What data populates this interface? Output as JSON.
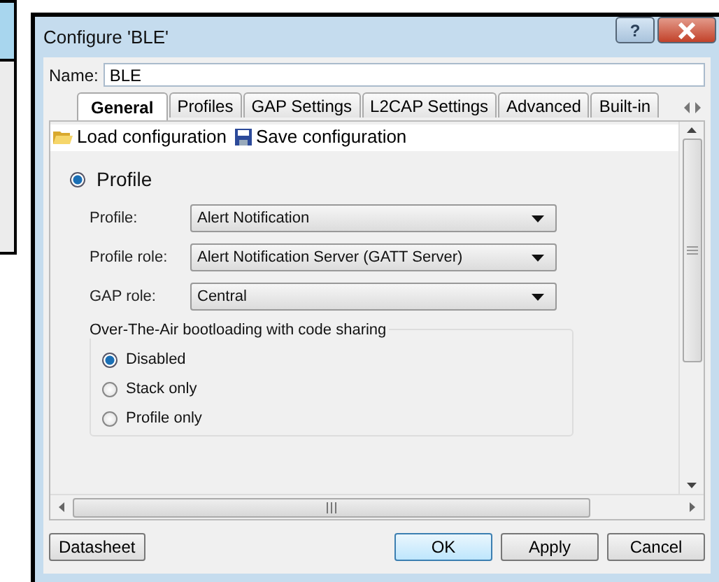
{
  "window": {
    "title": "Configure 'BLE'",
    "help_button": "?"
  },
  "name_field": {
    "label": "Name:",
    "value": "BLE"
  },
  "tabs": [
    {
      "label": "General",
      "selected": true
    },
    {
      "label": "Profiles",
      "selected": false
    },
    {
      "label": "GAP Settings",
      "selected": false
    },
    {
      "label": "L2CAP Settings",
      "selected": false
    },
    {
      "label": "Advanced",
      "selected": false
    },
    {
      "label": "Built-in",
      "selected": false
    }
  ],
  "toolbar": [
    {
      "label": "Load configuration",
      "kind": "folder"
    },
    {
      "label": "Save configuration",
      "kind": "disk"
    }
  ],
  "mode": {
    "label": "Profile",
    "selected": true
  },
  "dropdowns": [
    {
      "label": "Profile:",
      "value": "Alert Notification"
    },
    {
      "label": "Profile role:",
      "value": "Alert Notification Server (GATT Server)"
    },
    {
      "label": "GAP role:",
      "value": "Central"
    }
  ],
  "ota_group": {
    "title": "Over-The-Air bootloading with code sharing",
    "options": [
      {
        "label": "Disabled",
        "selected": true
      },
      {
        "label": "Stack only",
        "selected": false
      },
      {
        "label": "Profile only",
        "selected": false
      }
    ]
  },
  "buttons": [
    {
      "label": "Datasheet",
      "kind": "left",
      "default": false
    },
    {
      "label": "OK",
      "kind": "right",
      "default": true
    },
    {
      "label": "Apply",
      "kind": "right",
      "default": false
    },
    {
      "label": "Cancel",
      "kind": "right",
      "default": false
    }
  ]
}
